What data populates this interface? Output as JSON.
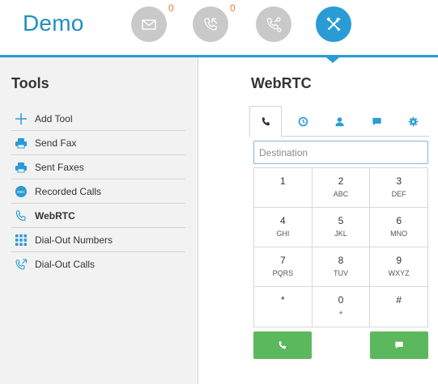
{
  "header": {
    "brand": "Demo",
    "nav": [
      {
        "name": "messages",
        "icon": "envelope-icon",
        "count": "0",
        "active": false
      },
      {
        "name": "calls",
        "icon": "phone-incoming-icon",
        "count": "0",
        "active": false
      },
      {
        "name": "connections",
        "icon": "phone-network-icon",
        "count": "",
        "active": false
      },
      {
        "name": "tools",
        "icon": "wrench-screwdriver-icon",
        "count": "",
        "active": true
      }
    ],
    "accent_color": "#2a9bd5",
    "count_color": "#f07a1e"
  },
  "sidebar": {
    "title": "Tools",
    "items": [
      {
        "label": "Add Tool",
        "icon": "plus-icon"
      },
      {
        "label": "Send Fax",
        "icon": "printer-icon"
      },
      {
        "label": "Sent Faxes",
        "icon": "printer-icon"
      },
      {
        "label": "Recorded Calls",
        "icon": "rec-icon"
      },
      {
        "label": "WebRTC",
        "icon": "phone-icon",
        "active": true
      },
      {
        "label": "Dial-Out Numbers",
        "icon": "grid-icon"
      },
      {
        "label": "Dial-Out Calls",
        "icon": "phone-outgoing-icon"
      }
    ]
  },
  "main": {
    "title": "WebRTC",
    "tabs": [
      {
        "name": "dialpad",
        "icon": "phone-icon",
        "active": true
      },
      {
        "name": "history",
        "icon": "clock-icon"
      },
      {
        "name": "contacts",
        "icon": "user-icon"
      },
      {
        "name": "messages",
        "icon": "chat-icon"
      },
      {
        "name": "settings",
        "icon": "gear-icon"
      }
    ],
    "destination": {
      "placeholder": "Destination",
      "value": ""
    },
    "keypad": [
      [
        {
          "digit": "1",
          "letters": ""
        },
        {
          "digit": "2",
          "letters": "ABC"
        },
        {
          "digit": "3",
          "letters": "DEF"
        }
      ],
      [
        {
          "digit": "4",
          "letters": "GHI"
        },
        {
          "digit": "5",
          "letters": "JKL"
        },
        {
          "digit": "6",
          "letters": "MNO"
        }
      ],
      [
        {
          "digit": "7",
          "letters": "PQRS"
        },
        {
          "digit": "8",
          "letters": "TUV"
        },
        {
          "digit": "9",
          "letters": "WXYZ"
        }
      ],
      [
        {
          "digit": "*",
          "letters": ""
        },
        {
          "digit": "0",
          "letters": "+"
        },
        {
          "digit": "#",
          "letters": ""
        }
      ]
    ],
    "buttons": {
      "call_icon": "phone-icon",
      "message_icon": "chat-icon",
      "color": "#5cb85c"
    }
  }
}
